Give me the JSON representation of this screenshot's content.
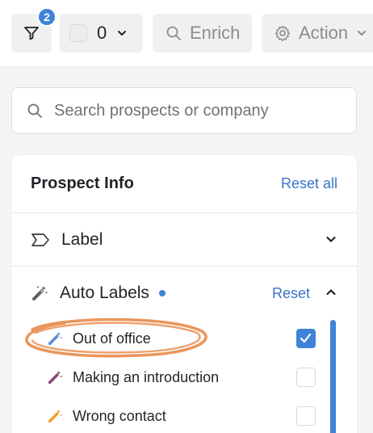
{
  "toolbar": {
    "filter_badge": "2",
    "selected_count": "0",
    "enrich_label": "Enrich",
    "action_label": "Action"
  },
  "search": {
    "placeholder": "Search prospects or company"
  },
  "panel": {
    "title": "Prospect Info",
    "reset_all_label": "Reset all",
    "sections": {
      "label": {
        "title": "Label",
        "expanded": false
      },
      "auto_labels": {
        "title": "Auto Labels",
        "reset_label": "Reset",
        "expanded": true
      }
    },
    "auto_label_items": [
      {
        "label": "Out of office",
        "checked": true,
        "icon_color": "#5b8fd8"
      },
      {
        "label": "Making an introduction",
        "checked": false,
        "icon_color": "#8c4a7a"
      },
      {
        "label": "Wrong contact",
        "checked": false,
        "icon_color": "#f0a030"
      }
    ]
  },
  "colors": {
    "accent": "#3e83d8",
    "link": "#3a74c5",
    "annotation": "#e88a4a"
  }
}
